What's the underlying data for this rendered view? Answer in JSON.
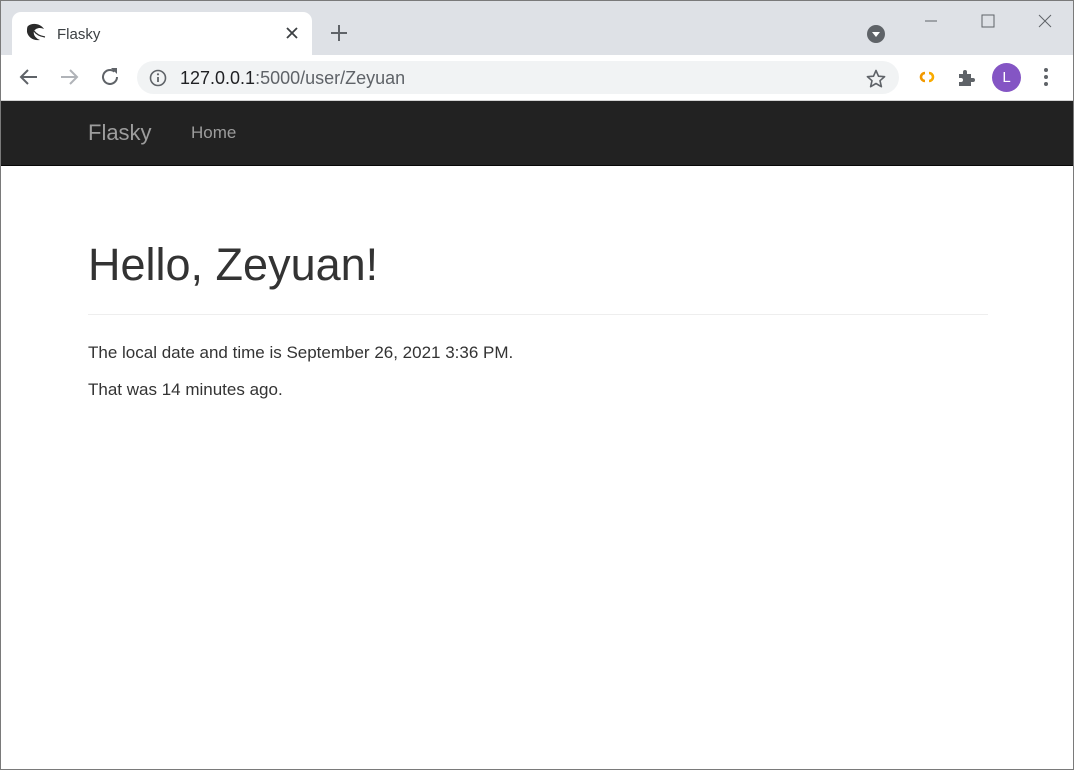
{
  "browser": {
    "tab": {
      "title": "Flasky",
      "favicon": "flask-horn-icon"
    },
    "url": {
      "host": "127.0.0.1",
      "rest": ":5000/user/Zeyuan"
    },
    "profile_initial": "L",
    "colors": {
      "tabstrip": "#dee1e6",
      "omnibox": "#f1f3f4",
      "avatar": "#8455c4",
      "extension_accent": "#f29900"
    }
  },
  "page": {
    "navbar": {
      "brand": "Flasky",
      "links": [
        "Home"
      ]
    },
    "heading": "Hello, Zeyuan!",
    "local_time_text": "The local date and time is September 26, 2021 3:36 PM.",
    "relative_time_text": "That was 14 minutes ago.",
    "colors": {
      "navbar_bg": "#222222",
      "navbar_text": "#9d9d9d",
      "body_text": "#333333"
    }
  }
}
